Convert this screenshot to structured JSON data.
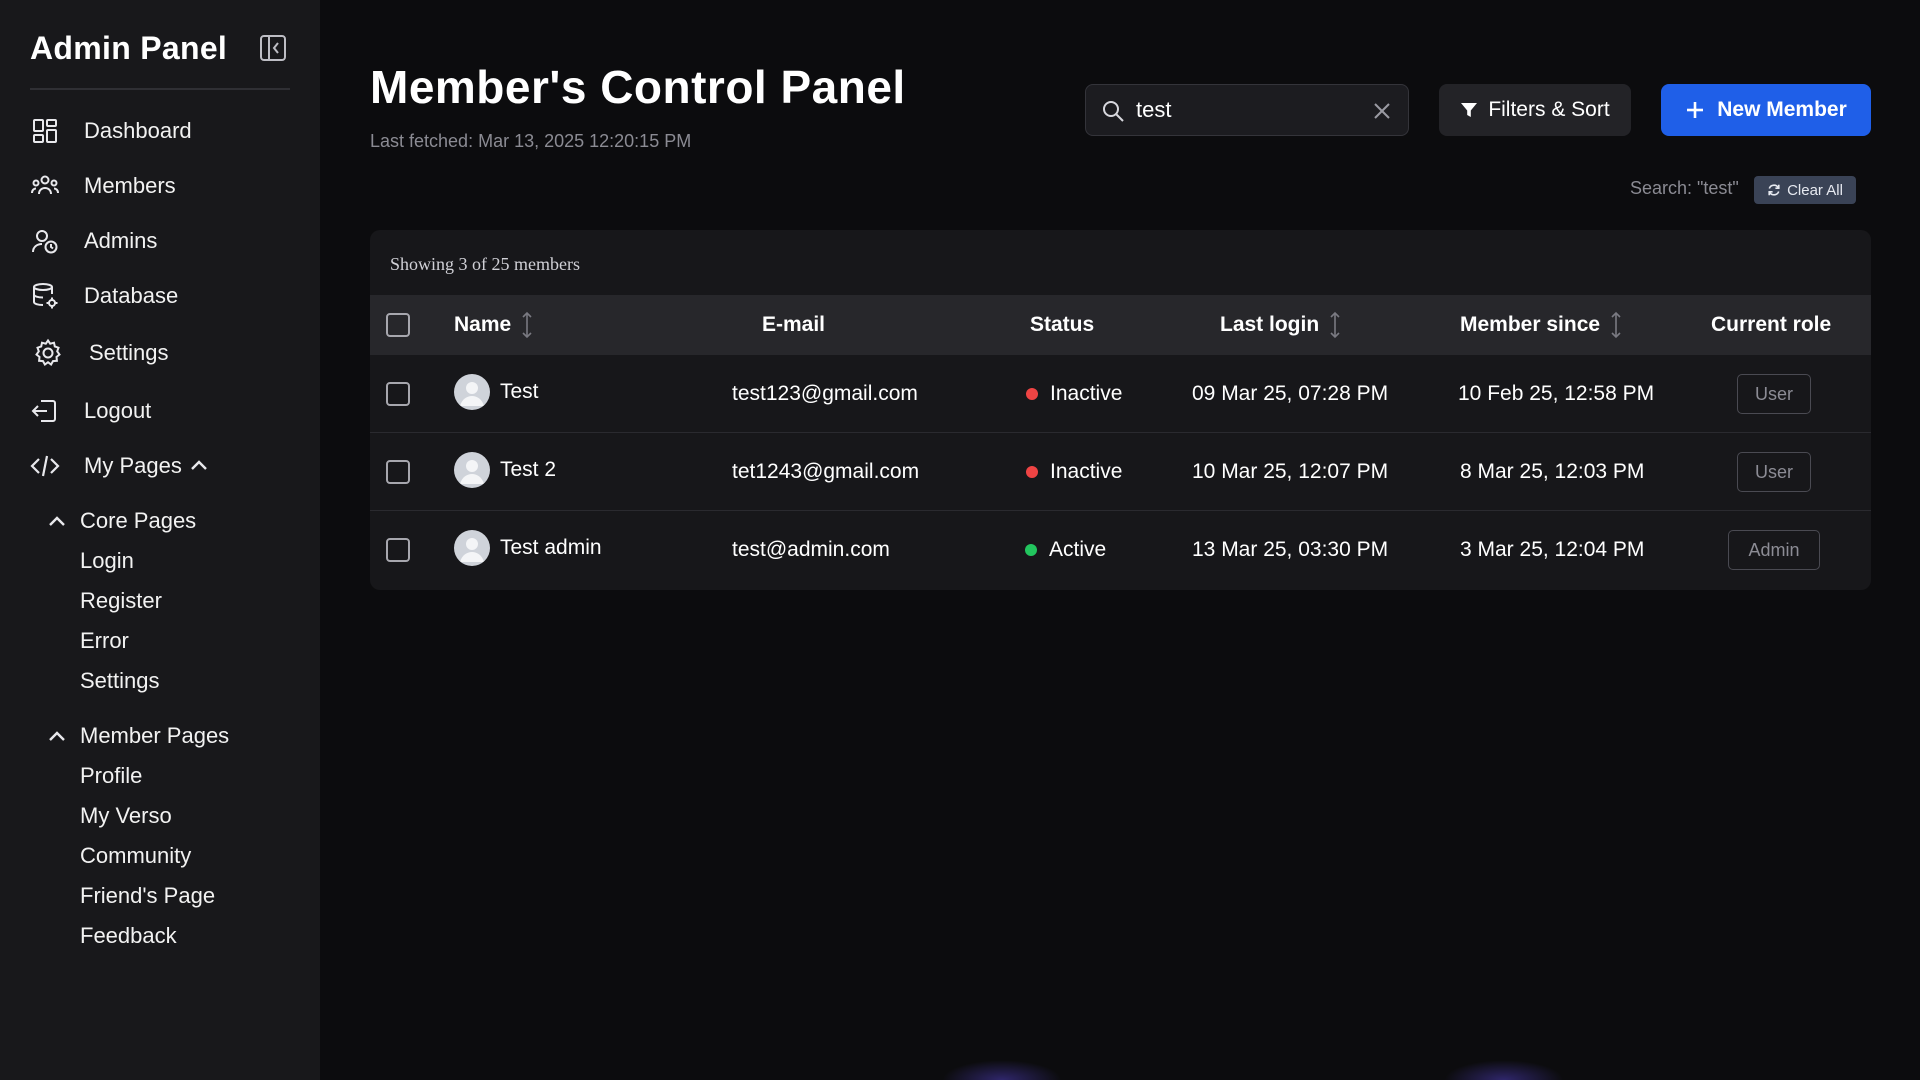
{
  "sidebar": {
    "title": "Admin Panel",
    "items": [
      {
        "label": "Dashboard",
        "icon": "dashboard-icon"
      },
      {
        "label": "Members",
        "icon": "members-icon"
      },
      {
        "label": "Admins",
        "icon": "admins-icon"
      },
      {
        "label": "Database",
        "icon": "database-icon"
      },
      {
        "label": "Settings",
        "icon": "gear-icon"
      },
      {
        "label": "Logout",
        "icon": "logout-icon"
      },
      {
        "label": "My Pages",
        "icon": "code-icon"
      }
    ],
    "core_pages": {
      "label": "Core Pages",
      "links": [
        "Login",
        "Register",
        "Error",
        "Settings"
      ]
    },
    "member_pages": {
      "label": "Member Pages",
      "links": [
        "Profile",
        "My Verso",
        "Community",
        "Friend's Page",
        "Feedback"
      ]
    }
  },
  "header": {
    "title": "Member's Control Panel",
    "last_fetched": "Last fetched: Mar 13, 2025 12:20:15 PM"
  },
  "search": {
    "value": "test",
    "status": "Search: \"test\"",
    "clear_all": "Clear All"
  },
  "toolbar": {
    "filters_label": "Filters & Sort",
    "new_member_label": "New Member",
    "accent": "#1f5fe8"
  },
  "table": {
    "showing": "Showing 3 of 25 members",
    "columns": {
      "name": "Name",
      "email": "E-mail",
      "status": "Status",
      "last_login": "Last login",
      "member_since": "Member since",
      "role": "Current role"
    },
    "rows": [
      {
        "name": "Test",
        "email": "test123@gmail.com",
        "status": "Inactive",
        "status_color": "#ef4444",
        "last_login": "09 Mar 25, 07:28 PM",
        "member_since": "10 Feb 25, 12:58 PM",
        "role": "User"
      },
      {
        "name": "Test 2",
        "email": "tet1243@gmail.com",
        "status": "Inactive",
        "status_color": "#ef4444",
        "last_login": "10 Mar 25, 12:07 PM",
        "member_since": "8 Mar 25, 12:03 PM",
        "role": "User"
      },
      {
        "name": "Test admin",
        "email": "test@admin.com",
        "status": "Active",
        "status_color": "#22c55e",
        "last_login": "13 Mar 25, 03:30 PM",
        "member_since": "3 Mar 25, 12:04 PM",
        "role": "Admin"
      }
    ]
  }
}
